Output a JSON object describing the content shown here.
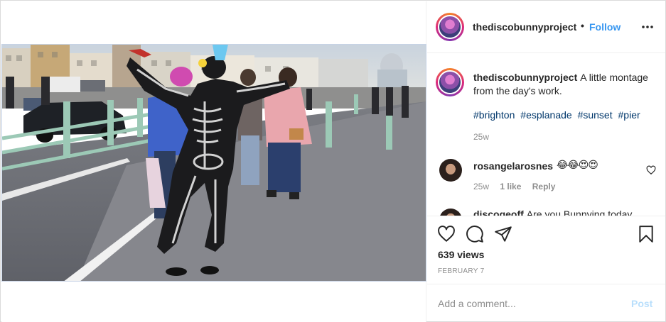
{
  "post": {
    "author": "thediscobunnyproject",
    "follow_separator": "•",
    "follow_label": "Follow",
    "caption": "A little montage from the day's work.",
    "hashtags": [
      "#brighton",
      "#esplanade",
      "#sunset",
      "#pier"
    ],
    "caption_age": "25w",
    "comments": [
      {
        "user": "rosangelarosnes",
        "text": "😂😂😍😍",
        "age": "25w",
        "likes": "1 like",
        "reply_label": "Reply"
      },
      {
        "user": "discogeoff",
        "text": "Are you Bunnying today"
      }
    ],
    "views": "639 views",
    "date": "FEBRUARY 7",
    "comment_placeholder": "Add a comment...",
    "post_label": "Post"
  },
  "icons": {
    "more": "more-options-icon",
    "like": "heart-icon",
    "comment": "comment-icon",
    "share": "share-icon",
    "save": "bookmark-icon",
    "comment_like": "heart-small-icon"
  },
  "colors": {
    "link": "#3897f0",
    "hashtag": "#00376b",
    "muted": "#8e8e8e",
    "post_disabled": "#b9dffc"
  }
}
